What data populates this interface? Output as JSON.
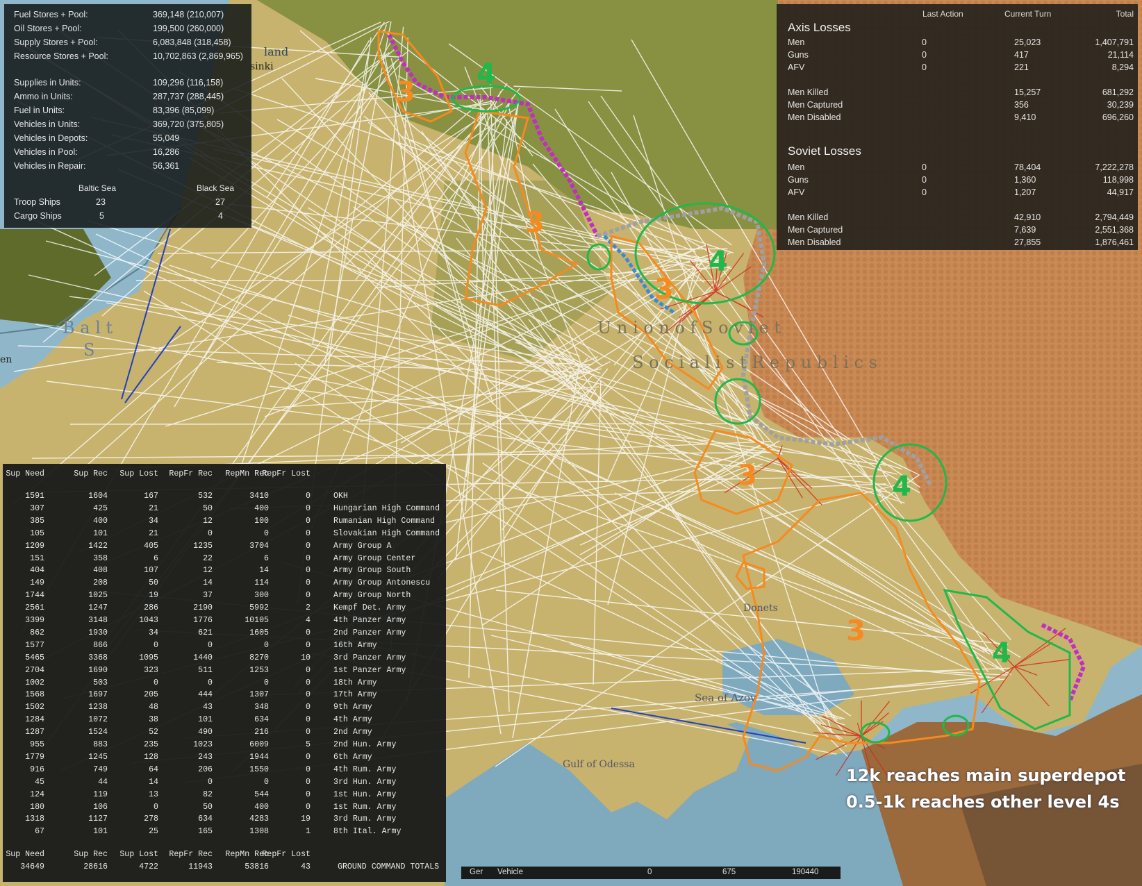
{
  "colors": {
    "steppe": "#c7b36e",
    "forest": "#6f7b2e",
    "sea": "#8fb7c9",
    "soviet_hex": "#c98a55",
    "supply_line": "#ffffff",
    "rail_red": "#d42a1a",
    "level3_outline": "#f58a20",
    "level4_outline": "#1fb84a",
    "axis_front": "#c030c0",
    "soviet_front": "#9a9a9a"
  },
  "map": {
    "labels": {
      "helsinki": "sinki",
      "finland": "land",
      "baltic_1": "B a l t",
      "baltic_2": "S",
      "west_edge": "en",
      "ussr_1": "U n i o n   o f   S o v i e t",
      "ussr_2": "S o c i a l i s t   R e p u b l i c s",
      "donets": "Donets",
      "azov": "Sea of Azov",
      "odessa": "Gulf of Odessa"
    },
    "level_marks": {
      "m3_north": "3",
      "m4_north": "4",
      "m3_center": "3",
      "m4_center": "4",
      "m3_mid": "3",
      "m3_south": "3",
      "m4_south": "4",
      "m3_crimea": "3",
      "m4_caucasus": "4"
    }
  },
  "stores": {
    "rows": [
      {
        "label": "Fuel Stores + Pool:",
        "value": "369,148 (210,007)"
      },
      {
        "label": "Oil Stores + Pool:",
        "value": "199,500 (260,000)"
      },
      {
        "label": "Supply Stores + Pool:",
        "value": "6,083,848 (318,458)"
      },
      {
        "label": "Resource Stores + Pool:",
        "value": "10,702,863 (2,869,965)"
      },
      {
        "label": "Supplies in Units:",
        "value": "109,296 (116,158)"
      },
      {
        "label": "Ammo in Units:",
        "value": "287,737 (288,445)"
      },
      {
        "label": "Fuel in Units:",
        "value": "83,396 (85,099)"
      },
      {
        "label": "Vehicles in Units:",
        "value": "369,720 (375,805)"
      },
      {
        "label": "Vehicles in Depots:",
        "value": "55,049"
      },
      {
        "label": "Vehicles in Pool:",
        "value": "16,286"
      },
      {
        "label": "Vehicles in Repair:",
        "value": "56,361"
      }
    ],
    "ships": {
      "col_baltic": "Baltic Sea",
      "col_black": "Black Sea",
      "rows": [
        {
          "label": "Troop Ships",
          "baltic": "23",
          "black": "27"
        },
        {
          "label": "Cargo Ships",
          "baltic": "5",
          "black": "4"
        }
      ]
    }
  },
  "losses": {
    "headers": {
      "last": "Last Action",
      "current": "Current Turn",
      "total": "Total"
    },
    "axis_title": "Axis Losses",
    "axis": [
      {
        "label": "Men",
        "last": "0",
        "current": "25,023",
        "total": "1,407,791"
      },
      {
        "label": "Guns",
        "last": "0",
        "current": "417",
        "total": "21,114"
      },
      {
        "label": "AFV",
        "last": "0",
        "current": "221",
        "total": "8,294"
      },
      {
        "label": "Men Killed",
        "last": "",
        "current": "15,257",
        "total": "681,292"
      },
      {
        "label": "Men Captured",
        "last": "",
        "current": "356",
        "total": "30,239"
      },
      {
        "label": "Men Disabled",
        "last": "",
        "current": "9,410",
        "total": "696,260"
      }
    ],
    "soviet_title": "Soviet Losses",
    "soviet": [
      {
        "label": "Men",
        "last": "0",
        "current": "78,404",
        "total": "7,222,278"
      },
      {
        "label": "Guns",
        "last": "0",
        "current": "1,360",
        "total": "118,998"
      },
      {
        "label": "AFV",
        "last": "0",
        "current": "1,207",
        "total": "44,917"
      },
      {
        "label": "Men Killed",
        "last": "",
        "current": "42,910",
        "total": "2,794,449"
      },
      {
        "label": "Men Captured",
        "last": "",
        "current": "7,639",
        "total": "2,551,368"
      },
      {
        "label": "Men Disabled",
        "last": "",
        "current": "27,855",
        "total": "1,876,461"
      }
    ]
  },
  "supply": {
    "headers": [
      "Sup Need",
      "Sup Rec",
      "Sup Lost",
      "RepFr Rec",
      "RepMn Rec",
      "RepFr Lost"
    ],
    "rows": [
      [
        "1591",
        "1604",
        "167",
        "532",
        "3410",
        "0",
        "OKH"
      ],
      [
        "307",
        "425",
        "21",
        "50",
        "400",
        "0",
        "Hungarian High Command"
      ],
      [
        "385",
        "400",
        "34",
        "12",
        "100",
        "0",
        "Rumanian High Command"
      ],
      [
        "105",
        "101",
        "21",
        "0",
        "0",
        "0",
        "Slovakian High Command"
      ],
      [
        "1209",
        "1422",
        "405",
        "1235",
        "3704",
        "0",
        "Army Group A"
      ],
      [
        "151",
        "358",
        "6",
        "22",
        "6",
        "0",
        "Army Group Center"
      ],
      [
        "404",
        "408",
        "107",
        "12",
        "14",
        "0",
        "Army Group South"
      ],
      [
        "149",
        "208",
        "50",
        "14",
        "114",
        "0",
        "Army Group Antonescu"
      ],
      [
        "1744",
        "1025",
        "19",
        "37",
        "300",
        "0",
        "Army Group North"
      ],
      [
        "2561",
        "1247",
        "286",
        "2190",
        "5992",
        "2",
        "Kempf Det. Army"
      ],
      [
        "3399",
        "3148",
        "1043",
        "1776",
        "10105",
        "4",
        "4th Panzer Army"
      ],
      [
        "862",
        "1930",
        "34",
        "621",
        "1605",
        "0",
        "2nd Panzer Army"
      ],
      [
        "1577",
        "866",
        "0",
        "0",
        "0",
        "0",
        "16th Army"
      ],
      [
        "5465",
        "3368",
        "1095",
        "1440",
        "8270",
        "10",
        "3rd Panzer Army"
      ],
      [
        "2704",
        "1690",
        "323",
        "511",
        "1253",
        "0",
        "1st Panzer Army"
      ],
      [
        "1002",
        "503",
        "0",
        "0",
        "0",
        "0",
        "18th Army"
      ],
      [
        "1568",
        "1697",
        "205",
        "444",
        "1307",
        "0",
        "17th Army"
      ],
      [
        "1502",
        "1238",
        "48",
        "43",
        "348",
        "0",
        "9th Army"
      ],
      [
        "1284",
        "1072",
        "38",
        "101",
        "634",
        "0",
        "4th Army"
      ],
      [
        "1287",
        "1524",
        "52",
        "490",
        "216",
        "0",
        "2nd Army"
      ],
      [
        "955",
        "883",
        "235",
        "1023",
        "6009",
        "5",
        "2nd Hun. Army"
      ],
      [
        "1779",
        "1245",
        "128",
        "243",
        "1944",
        "0",
        "6th Army"
      ],
      [
        "916",
        "749",
        "64",
        "206",
        "1550",
        "0",
        "4th Rum. Army"
      ],
      [
        "45",
        "44",
        "14",
        "0",
        "0",
        "0",
        "3rd Hun. Army"
      ],
      [
        "124",
        "119",
        "13",
        "82",
        "544",
        "0",
        "1st Hun. Army"
      ],
      [
        "180",
        "106",
        "0",
        "50",
        "400",
        "0",
        "1st Rum. Army"
      ],
      [
        "1318",
        "1127",
        "278",
        "634",
        "4283",
        "19",
        "3rd Rum. Army"
      ],
      [
        "67",
        "101",
        "25",
        "165",
        "1308",
        "1",
        "8th Ital. Army"
      ]
    ],
    "totals": [
      "34649",
      "28616",
      "4722",
      "11943",
      "53816",
      "43",
      "GROUND COMMAND TOTALS"
    ]
  },
  "status_bar": {
    "side": "Ger",
    "type": "Vehicle",
    "v1": "0",
    "v2": "675",
    "v3": "190440"
  },
  "annotation": {
    "line1": "12k reaches main superdepot",
    "line2": "0.5-1k reaches other level 4s"
  }
}
